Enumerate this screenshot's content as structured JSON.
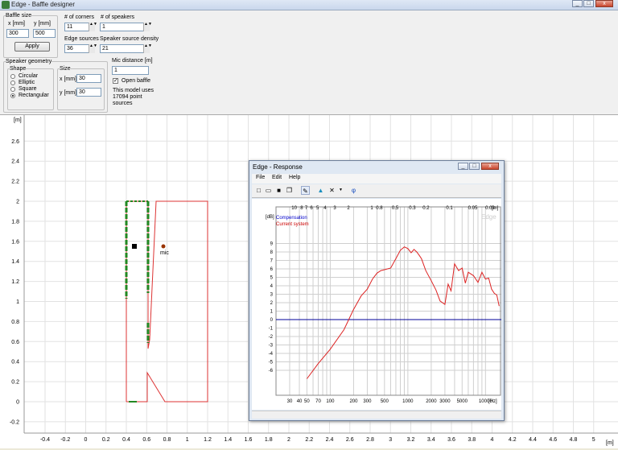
{
  "window": {
    "title": "Edge - Baffle designer",
    "min": "_",
    "max": "□",
    "close": "x"
  },
  "baffle_size": {
    "legend": "Baffle size",
    "x_label": "x [mm]",
    "y_label": "y [mm]",
    "x_value": "300",
    "y_value": "500",
    "apply": "Apply"
  },
  "corners": {
    "label": "# of corners",
    "value": "11"
  },
  "speakers": {
    "label": "# of speakers",
    "value": "1"
  },
  "edge_sources": {
    "label": "Edge sources",
    "value": "36"
  },
  "density": {
    "label": "Speaker source density",
    "value": "21"
  },
  "geometry": {
    "legend": "Speaker geometry",
    "shape_legend": "Shape",
    "options": [
      "Circular",
      "Elliptic",
      "Square",
      "Rectangular"
    ],
    "selected": 3,
    "size_legend": "Size",
    "x_label": "x [mm]",
    "y_label": "y [mm]",
    "x_value": "30",
    "y_value": "30"
  },
  "mic": {
    "label": "Mic distance [m]",
    "value": "1",
    "open_baffle": "Open baffle",
    "open_checked": "✓",
    "info_line1": "This model uses",
    "info_line2": "17094 point",
    "info_line3": "sources",
    "marker": "mic"
  },
  "main_plot": {
    "y_unit": "[m]",
    "x_unit": "[m]",
    "y_ticks": [
      "2.6",
      "2.4",
      "2.2",
      "2",
      "1.8",
      "1.6",
      "1.4",
      "1.2",
      "1",
      "0.8",
      "0.6",
      "0.4",
      "0.2",
      "0",
      "-0.2"
    ],
    "x_ticks": [
      "-0.4",
      "-0.2",
      "0",
      "0.2",
      "0.4",
      "0.6",
      "0.8",
      "1",
      "1.2",
      "1.4",
      "1.6",
      "1.8",
      "2",
      "2.2",
      "2.4",
      "2.6",
      "2.8",
      "3",
      "3.2",
      "3.4",
      "3.6",
      "3.8",
      "4",
      "4.2",
      "4.4",
      "4.6",
      "4.8",
      "5"
    ]
  },
  "response": {
    "title": "Edge - Response",
    "menu": [
      "File",
      "Edit",
      "Help"
    ],
    "db_unit": "[dB]",
    "hz_unit": "[Hz]",
    "m_unit": "[m]",
    "watermark": "Edge",
    "legend": [
      {
        "name": "Compensation",
        "color": "#0000cc"
      },
      {
        "name": "Current system",
        "color": "#cc0000"
      }
    ],
    "y_ticks": [
      "9",
      "8",
      "7",
      "6",
      "5",
      "4",
      "3",
      "2",
      "1",
      "0",
      "-1",
      "-2",
      "-3",
      "-4",
      "-5",
      "-6"
    ],
    "x_ticks": [
      "30",
      "40",
      "50",
      "70",
      "100",
      "200",
      "300",
      "500",
      "1000",
      "2000",
      "3000",
      "5000",
      "10000"
    ],
    "m_ticks": [
      "10",
      "8",
      "7",
      "6",
      "5",
      "4",
      "3",
      "2",
      "1",
      "0.8",
      "0.5",
      "0.3",
      "0.2",
      "0.1",
      "0.05",
      "0.03"
    ]
  },
  "chart_data": {
    "type": "line",
    "xlabel": "[Hz]",
    "ylabel": "[dB]",
    "xscale": "log",
    "xlim": [
      20,
      16000
    ],
    "ylim": [
      -7,
      10
    ],
    "series": [
      {
        "name": "Compensation",
        "x": [
          20,
          16000
        ],
        "y": [
          0,
          0
        ]
      },
      {
        "name": "Current system",
        "x": [
          50,
          70,
          100,
          150,
          200,
          250,
          300,
          350,
          400,
          450,
          500,
          600,
          700,
          800,
          900,
          1000,
          1100,
          1200,
          1300,
          1400,
          1500,
          1700,
          2000,
          2300,
          2600,
          3000,
          3300,
          3600,
          4000,
          4500,
          5000,
          5500,
          6000,
          7000,
          8000,
          9000,
          10000,
          11000,
          12000,
          13000,
          14000,
          15000
        ],
        "y": [
          -7,
          -5.2,
          -3.5,
          -1.2,
          1.2,
          2.8,
          3.6,
          4.8,
          5.5,
          5.8,
          5.9,
          6.1,
          7.2,
          8.2,
          8.6,
          8.4,
          7.9,
          8.3,
          8,
          7.6,
          7.2,
          5.8,
          4.6,
          3.5,
          2.2,
          1.8,
          4.2,
          3.4,
          6.6,
          5.8,
          6.1,
          4.3,
          5.6,
          5.2,
          4.4,
          5.6,
          4.8,
          4.9,
          3.6,
          3.1,
          2.9,
          1.6
        ]
      }
    ]
  }
}
